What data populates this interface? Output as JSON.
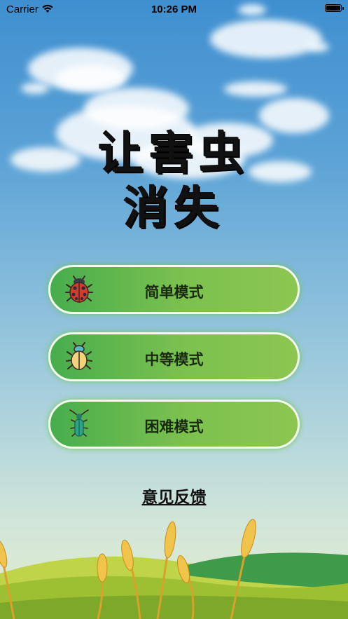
{
  "status_bar": {
    "carrier": "Carrier",
    "time": "10:26 PM"
  },
  "title": {
    "line1": "让害虫",
    "line2": "消失"
  },
  "modes": [
    {
      "label": "简单模式",
      "icon": "ladybug-icon"
    },
    {
      "label": "中等模式",
      "icon": "beetle-icon"
    },
    {
      "label": "困难模式",
      "icon": "longhorn-beetle-icon"
    }
  ],
  "feedback_label": "意见反馈",
  "colors": {
    "button_green_left": "#47ad4d",
    "button_green_right": "#8cc650",
    "sky_top": "#3f8fd0"
  }
}
